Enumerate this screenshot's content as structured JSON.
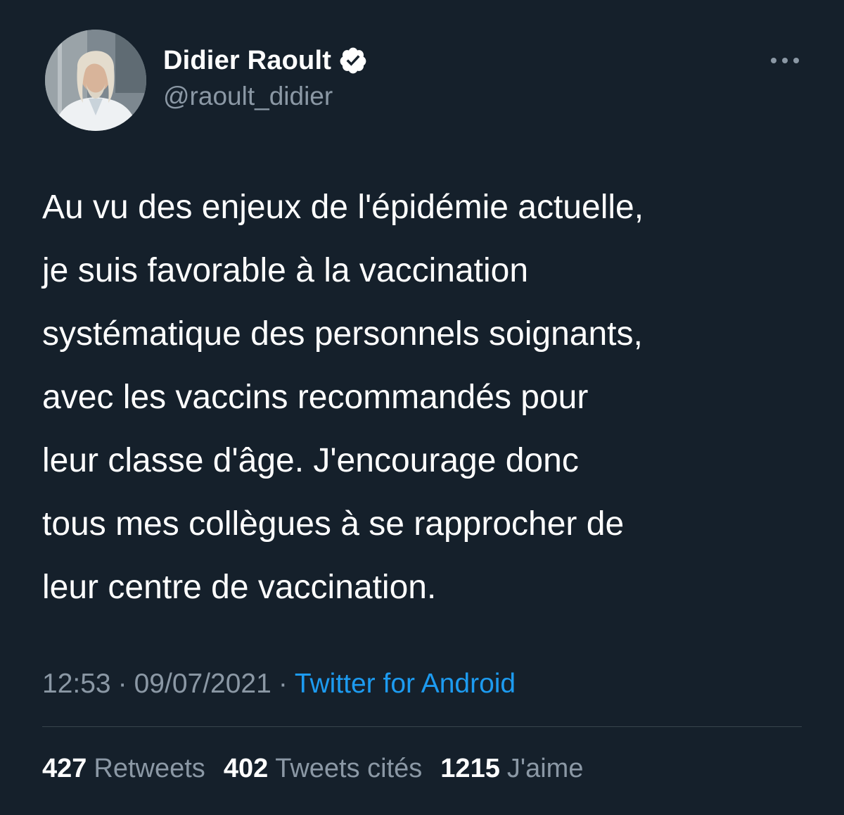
{
  "author": {
    "display_name": "Didier Raoult",
    "handle": "@raoult_didier",
    "verified_icon": "verified-badge-icon",
    "avatar_icon": "profile-photo"
  },
  "more_icon": "more-horizontal-icon",
  "tweet": {
    "text": "Au vu des enjeux de l'épidémie actuelle,\nje suis favorable à la vaccination\nsystématique des personnels soignants,\navec les vaccins recommandés pour\nleur classe d'âge. J'encourage donc\ntous mes collègues à se rapprocher de\nleur centre de vaccination."
  },
  "meta": {
    "time": "12:53",
    "date": "09/07/2021",
    "separator": "·",
    "source": "Twitter for Android"
  },
  "stats": {
    "retweets_count": "427",
    "retweets_label": "Retweets",
    "quotes_count": "402",
    "quotes_label": "Tweets cités",
    "likes_count": "1215",
    "likes_label": "J'aime"
  },
  "colors": {
    "background": "#15202b",
    "text": "#ffffff",
    "secondary_text": "#8b98a5",
    "link": "#1d9bf0",
    "divider": "#38444d",
    "verified_badge": "#ffffff"
  }
}
